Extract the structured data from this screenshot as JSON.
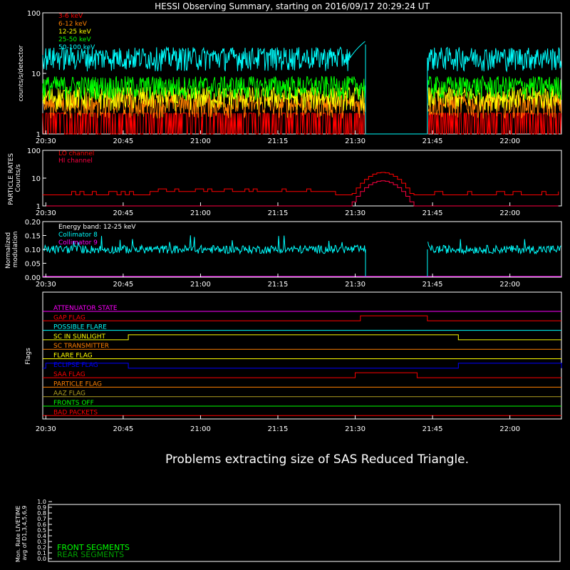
{
  "title": "HESSI Observing Summary, starting on 2016/09/17 20:29:24 UT",
  "message": "Problems extracting size of SAS Reduced Triangle.",
  "time_ticks": [
    "20:30",
    "20:45",
    "21:00",
    "21:15",
    "21:30",
    "21:45",
    "22:00"
  ],
  "colors": {
    "red": "#ff0000",
    "orange": "#ff8000",
    "yellow": "#ffff00",
    "green": "#00ff00",
    "cyan": "#00ffff",
    "magenta": "#ff00ff",
    "crimson": "#ff0040",
    "blue": "#0000ff",
    "olive": "#b0a020",
    "darkgreen": "#00a000"
  },
  "chart_data": [
    {
      "type": "line",
      "panel": "counts",
      "ylabel": "counts/s/detector",
      "yscale": "log",
      "ylim": [
        1,
        100
      ],
      "yticks": [
        "1",
        "10",
        "100"
      ],
      "x_range": [
        "20:30",
        "22:10"
      ],
      "gap": [
        "21:32",
        "21:44"
      ],
      "series": [
        {
          "name": "3-6 keV",
          "color": "#ff0000",
          "base": 1.5
        },
        {
          "name": "6-12 keV",
          "color": "#ff8000",
          "base": 3
        },
        {
          "name": "12-25 keV",
          "color": "#ffff00",
          "base": 4
        },
        {
          "name": "25-50 keV",
          "color": "#00ff00",
          "base": 6
        },
        {
          "name": "50-100 keV",
          "color": "#00ffff",
          "base": 18
        }
      ]
    },
    {
      "type": "line",
      "panel": "particle",
      "ylabel": "PARTICLE RATES Counts/s",
      "yscale": "log",
      "ylim": [
        1,
        100
      ],
      "yticks": [
        "1",
        "10",
        "100"
      ],
      "series": [
        {
          "name": "LO channel",
          "color": "#ff0000",
          "base": 3,
          "peak": 16
        },
        {
          "name": "HI channel",
          "color": "#ff0040",
          "base": 1,
          "peak": 8
        }
      ]
    },
    {
      "type": "line",
      "panel": "modulation",
      "ylabel": "Normalized modulation",
      "ylim": [
        0,
        0.2
      ],
      "yticks": [
        "0.00",
        "0.05",
        "0.10",
        "0.15",
        "0.20"
      ],
      "annotation": "Energy band: 12-25 keV",
      "series": [
        {
          "name": "Collimator 8",
          "color": "#00ffff",
          "base": 0.1
        },
        {
          "name": "Collimator 9",
          "color": "#ff00ff",
          "base": 0.0
        }
      ]
    },
    {
      "type": "table",
      "panel": "flags",
      "ylabel": "Flags",
      "flags": [
        {
          "name": "ATTENUATOR STATE",
          "color": "#ff00ff",
          "high": []
        },
        {
          "name": "GAP FLAG",
          "color": "#ff0000",
          "high": [
            [
              "21:31",
              "21:44"
            ]
          ]
        },
        {
          "name": "POSSIBLE FLARE",
          "color": "#00ffff",
          "high": []
        },
        {
          "name": "SC IN SUNLIGHT",
          "color": "#ffff00",
          "high": [
            [
              "20:46",
              "21:50"
            ]
          ]
        },
        {
          "name": "SC TRANSMITTER",
          "color": "#ff8000",
          "high": []
        },
        {
          "name": "FLARE FLAG",
          "color": "#ffff00",
          "high": []
        },
        {
          "name": "ECLIPSE FLAG",
          "color": "#0000ff",
          "high": [
            [
              "20:30",
              "20:46"
            ],
            [
              "21:50",
              "22:10"
            ]
          ]
        },
        {
          "name": "SAA FLAG",
          "color": "#ff0000",
          "high": [
            [
              "21:30",
              "21:42"
            ]
          ]
        },
        {
          "name": "PARTICLE FLAG",
          "color": "#ff8000",
          "high": []
        },
        {
          "name": "AAZ FLAG",
          "color": "#b0a020",
          "high": []
        },
        {
          "name": "FRONTS OFF",
          "color": "#00ff00",
          "high": []
        },
        {
          "name": "BAD PACKETS",
          "color": "#ff0000",
          "high": []
        }
      ]
    },
    {
      "type": "line",
      "panel": "livetime",
      "ylabel": "Mon. Rate LIVETIME avg of D1,3,4,5,6,9",
      "ylim": [
        0,
        1
      ],
      "yticks": [
        "0.0",
        "0.1",
        "0.2",
        "0.3",
        "0.4",
        "0.5",
        "0.6",
        "0.7",
        "0.8",
        "0.9",
        "1.0"
      ],
      "series": [
        {
          "name": "FRONT SEGMENTS",
          "color": "#00ff00"
        },
        {
          "name": "REAR SEGMENTS",
          "color": "#00a000"
        }
      ]
    }
  ]
}
